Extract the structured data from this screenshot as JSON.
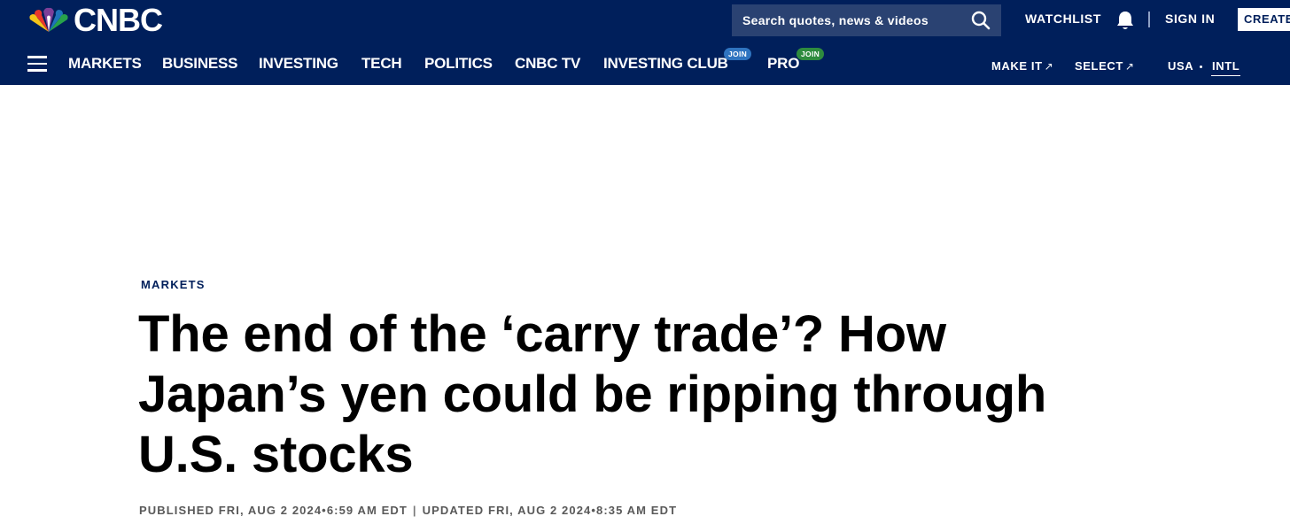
{
  "header": {
    "brand": "CNBC",
    "search_placeholder": "Search quotes, news & videos",
    "watchlist": "WATCHLIST",
    "sign_in": "SIGN IN",
    "create": "CREATE"
  },
  "nav": {
    "items": [
      {
        "label": "MARKETS"
      },
      {
        "label": "BUSINESS"
      },
      {
        "label": "INVESTING"
      },
      {
        "label": "TECH"
      },
      {
        "label": "POLITICS"
      },
      {
        "label": "CNBC TV"
      },
      {
        "label": "INVESTING CLUB",
        "badge": "JOIN"
      },
      {
        "label": "PRO",
        "badge": "JOIN"
      }
    ],
    "secondary": {
      "make_it": "MAKE IT",
      "select": "SELECT",
      "usa": "USA",
      "intl": "INTL"
    }
  },
  "article": {
    "kicker": "MARKETS",
    "headline_lines": [
      "The end of the ‘carry trade’? How",
      "Japan’s yen could be ripping through",
      "U.S. stocks"
    ],
    "published": "PUBLISHED FRI, AUG 2 2024•6:59 AM EDT",
    "separator": "|",
    "updated": "UPDATED FRI, AUG 2 2024•8:35 AM EDT"
  },
  "icons": {
    "logo": "peacock-logo-icon",
    "search": "search-icon",
    "bell": "bell-icon",
    "menu": "menu-icon",
    "external": "external-link-icon"
  },
  "colors": {
    "header_bg": "#001f5b",
    "search_bg": "#2a4272",
    "join_blue": "#2f74c0",
    "join_green": "#2e8b3e",
    "kicker": "#001f5b",
    "byline": "#595959"
  }
}
